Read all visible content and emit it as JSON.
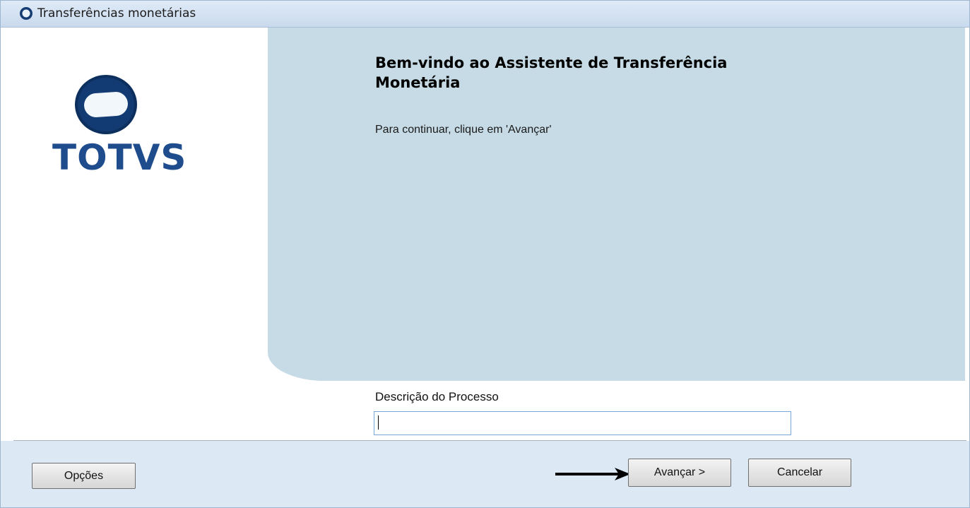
{
  "window": {
    "title": "Transferências monetárias"
  },
  "branding": {
    "logo_text": "TOTVS",
    "logo_icon": "totvs-logo-icon"
  },
  "wizard": {
    "heading": "Bem-vindo ao Assistente de Transferência Monetária",
    "instruction": "Para continuar, clique em 'Avançar'"
  },
  "form": {
    "description_label": "Descrição do Processo",
    "description_value": ""
  },
  "footer": {
    "options_label": "Opções",
    "next_label": "Avançar >",
    "cancel_label": "Cancelar"
  },
  "annotation": {
    "arrow_icon": "right-arrow-icon"
  },
  "colors": {
    "content_panel": "#c6dbe5",
    "footer": "#dde8f5",
    "logo_blue": "#1e4c8d"
  }
}
